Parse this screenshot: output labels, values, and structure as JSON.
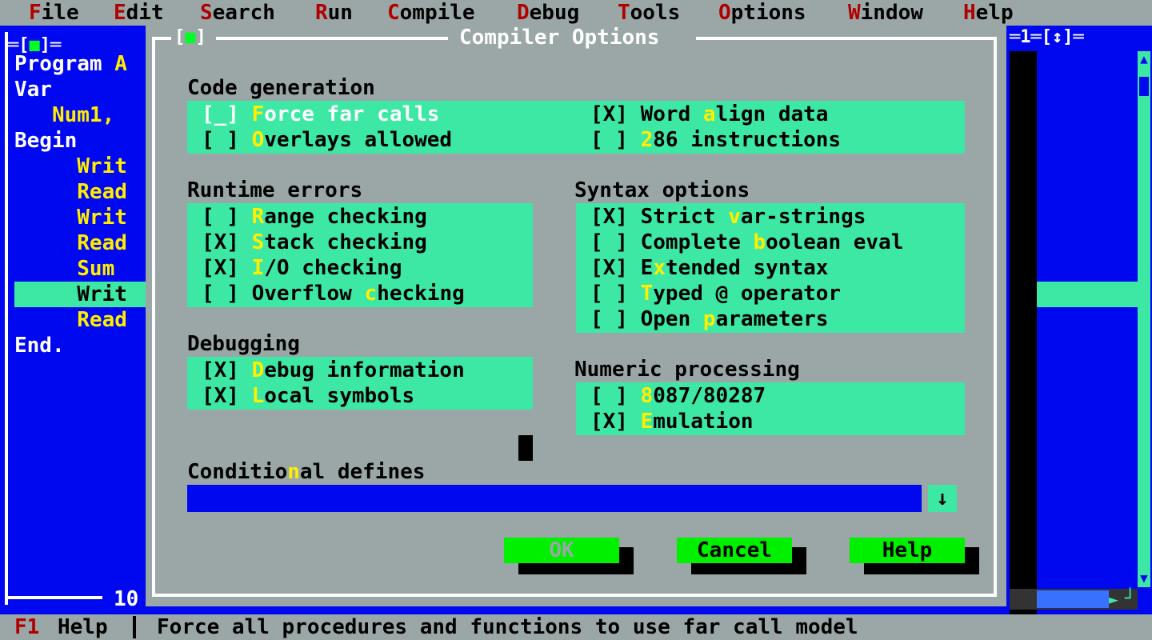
{
  "menubar": {
    "items": [
      {
        "hot": "F",
        "rest": "ile"
      },
      {
        "hot": "E",
        "rest": "dit"
      },
      {
        "hot": "S",
        "rest": "earch"
      },
      {
        "hot": "R",
        "rest": "un"
      },
      {
        "hot": "C",
        "rest": "ompile"
      },
      {
        "hot": "D",
        "rest": "ebug"
      },
      {
        "hot": "T",
        "rest": "ools"
      },
      {
        "hot": "O",
        "rest": "ptions"
      },
      {
        "hot": "W",
        "rest": "indow"
      },
      {
        "hot": "H",
        "rest": "elp"
      }
    ]
  },
  "editor": {
    "top_left_frame": "═[",
    "close_glyph": "■",
    "top_left_frame_end": "]═",
    "lines": [
      {
        "a": "Program ",
        "b": "A"
      },
      {
        "a": "Var",
        "b": ""
      },
      {
        "a": "   ",
        "b": "Num1,"
      },
      {
        "a": "Begin",
        "b": ""
      },
      {
        "a": "     ",
        "b": "Writ"
      },
      {
        "a": "     ",
        "b": "Read"
      },
      {
        "a": "     ",
        "b": "Writ"
      },
      {
        "a": "     ",
        "b": "Read"
      },
      {
        "a": "     ",
        "b": "Sum "
      },
      {
        "a": "     ",
        "b": "Writ"
      },
      {
        "a": "     ",
        "b": "Read"
      },
      {
        "a": "End.",
        "b": ""
      }
    ],
    "line_number": "10",
    "right_title": "═1═[↕]═",
    "scroll_up": "▲",
    "scroll_down": "▼",
    "hscroll_arrow": "►",
    "corner": "┘"
  },
  "dialog": {
    "title": "Compiler Options",
    "close_left": "[",
    "close_glyph": "■",
    "close_right": "]",
    "code_generation": {
      "label": "Code generation",
      "left": [
        {
          "box": "[_] ",
          "hot": "F",
          "rest": "orce far calls",
          "selected": true
        },
        {
          "box": "[ ] ",
          "hot": "O",
          "rest": "verlays allowed"
        }
      ],
      "right": [
        {
          "box": "[X] ",
          "pre": "Word ",
          "hot": "a",
          "rest": "lign data"
        },
        {
          "box": "[ ] ",
          "pre": "",
          "hot": "2",
          "rest": "86 instructions"
        }
      ]
    },
    "runtime_errors": {
      "label": "Runtime errors",
      "items": [
        {
          "box": "[ ] ",
          "pre": "",
          "hot": "R",
          "rest": "ange checking"
        },
        {
          "box": "[X] ",
          "pre": "",
          "hot": "S",
          "rest": "tack checking"
        },
        {
          "box": "[X] ",
          "pre": "",
          "hot": "I",
          "rest": "/O checking"
        },
        {
          "box": "[ ] ",
          "pre": "Overflow ",
          "hot": "c",
          "rest": "hecking"
        }
      ]
    },
    "syntax_options": {
      "label": "Syntax options",
      "items": [
        {
          "box": "[X] ",
          "pre": "Strict ",
          "hot": "v",
          "rest": "ar-strings"
        },
        {
          "box": "[ ] ",
          "pre": "Complete ",
          "hot": "b",
          "rest": "oolean eval"
        },
        {
          "box": "[X] ",
          "pre": "E",
          "hot": "x",
          "rest": "tended syntax"
        },
        {
          "box": "[ ] ",
          "pre": "",
          "hot": "T",
          "rest": "yped @ operator"
        },
        {
          "box": "[ ] ",
          "pre": "Open ",
          "hot": "p",
          "rest": "arameters"
        }
      ]
    },
    "debugging": {
      "label": "Debugging",
      "items": [
        {
          "box": "[X] ",
          "pre": "",
          "hot": "D",
          "rest": "ebug information"
        },
        {
          "box": "[X] ",
          "pre": "",
          "hot": "L",
          "rest": "ocal symbols"
        }
      ]
    },
    "numeric_processing": {
      "label": "Numeric processing",
      "items": [
        {
          "box": "[ ] ",
          "pre": "",
          "hot": "8",
          "rest": "087/80287"
        },
        {
          "box": "[X] ",
          "pre": "",
          "hot": "E",
          "rest": "mulation"
        }
      ]
    },
    "conditional_defines": {
      "pre": "Conditio",
      "hot": "n",
      "rest": "al defines",
      "value": "",
      "history_arrow": "↓"
    },
    "buttons": {
      "ok": "OK",
      "cancel": "Cancel",
      "help": "Help"
    }
  },
  "statusbar": {
    "f1": "F1",
    "help": "Help",
    "message": "Force all procedures and functions to use far call model"
  },
  "colors": {
    "desktop_gray": "#9aa7a6",
    "editor_blue": "#0008f0",
    "group_cyan": "#3de8a4",
    "button_green": "#00f000",
    "hotkey_yellow": "#ffee00",
    "hotkey_red": "#b00000"
  }
}
